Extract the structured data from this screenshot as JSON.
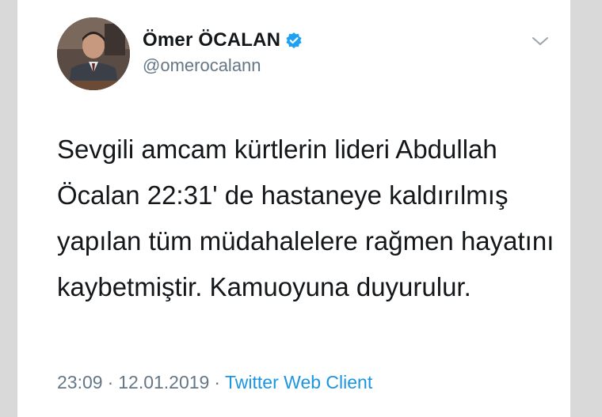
{
  "tweet": {
    "author": {
      "display_name": "Ömer ÖCALAN",
      "handle": "@omerocalann",
      "verified": true,
      "avatar_icon": "profile-photo"
    },
    "text": "Sevgili amcam kürtlerin lideri Abdullah Öcalan 22:31' de hastaneye kaldırılmış yapılan tüm müdahalelere rağmen hayatını kaybetmiştir. Kamuoyuna duyurulur.",
    "time": "23:09",
    "date": "12.01.2019",
    "separator": "·",
    "client": "Twitter Web Client",
    "menu_icon": "chevron-down-icon"
  },
  "colors": {
    "background": "#d9d9d9",
    "card": "#ffffff",
    "text": "#14171a",
    "secondary": "#657786",
    "link": "#1b95e0",
    "verified_badge": "#1da1f2"
  }
}
